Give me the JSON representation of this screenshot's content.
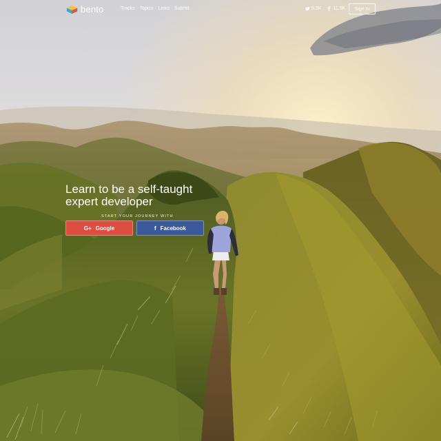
{
  "brand": {
    "name": "bento",
    "logo_icon": "cube-logo-icon"
  },
  "nav": {
    "items": [
      "Tracks",
      "Topics",
      "Links",
      "Submit"
    ]
  },
  "social": {
    "twitter": {
      "icon": "twitter-icon",
      "count": "9.3K"
    },
    "facebook": {
      "icon": "facebook-icon",
      "count": "11.5K"
    }
  },
  "header": {
    "signin_label": "Sign In"
  },
  "hero": {
    "title_line1": "Learn to be a self-taught",
    "title_line2": "expert developer",
    "subtitle": "START YOUR JOURNEY WITH"
  },
  "buttons": {
    "google": {
      "label": "Google",
      "icon": "G+",
      "color": "#dc4e41"
    },
    "facebook": {
      "label": "Facebook",
      "icon": "f",
      "color": "#3b5998"
    }
  }
}
